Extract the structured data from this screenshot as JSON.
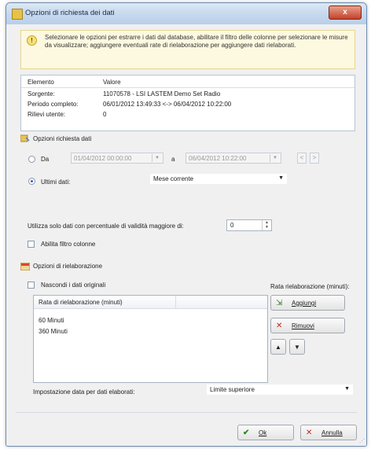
{
  "window": {
    "title": "Opzioni di richiesta dei dati",
    "close_glyph": "x"
  },
  "info": {
    "icon": "lightbulb-icon",
    "text": "Selezionare le opzioni per estrarre i dati dal database, abilitare il filtro delle colonne per selezionare le misure da visualizzare; aggiungere eventuali rate di rielaborazione per aggiungere dati rielaborati."
  },
  "properties": {
    "header": {
      "key": "Elemento",
      "value": "Valore"
    },
    "rows": [
      {
        "key": "Sorgente:",
        "value": "11070578 - LSI LASTEM Demo Set Radio"
      },
      {
        "key": "Periodo completo:",
        "value": "06/01/2012 13:49:33 <-> 06/04/2012 10:22:00"
      },
      {
        "key": "Rilievi utente:",
        "value": "0"
      }
    ]
  },
  "request_options": {
    "section_title": "Opzioni richiesta dati",
    "da_label": "Da",
    "from_date": "01/04/2012 00:00:00",
    "to_label": "a",
    "to_date": "06/04/2012 10:22:00",
    "prev_glyph": "<",
    "next_glyph": ">",
    "ultimi_label": "Ultimi dati:",
    "ultimi_value": "Mese corrente",
    "validity_label": "Utilizza solo dati con percentuale di validità maggiore di:",
    "validity_value": "0",
    "filter_label": "Abilita filtro colonne"
  },
  "elaboration": {
    "section_title": "Opzioni di rielaborazione",
    "hide_original_label": "Nascondi i dati originali",
    "rate_group_label": "Rata rielaborazione (minuti):",
    "grid_header": "Rata di rielaborazione (minuti)",
    "grid_rows": [
      "60 Minuti",
      "360 Minuti"
    ],
    "add_label": "Aggiungi",
    "remove_label": "Rimuovi",
    "up_glyph": "▲",
    "down_glyph": "▼",
    "date_setting_label": "Impostazione data per dati elaborati:",
    "date_setting_value": "Limite superiore"
  },
  "footer": {
    "ok_label": "Ok",
    "cancel_label": "Annulla"
  }
}
